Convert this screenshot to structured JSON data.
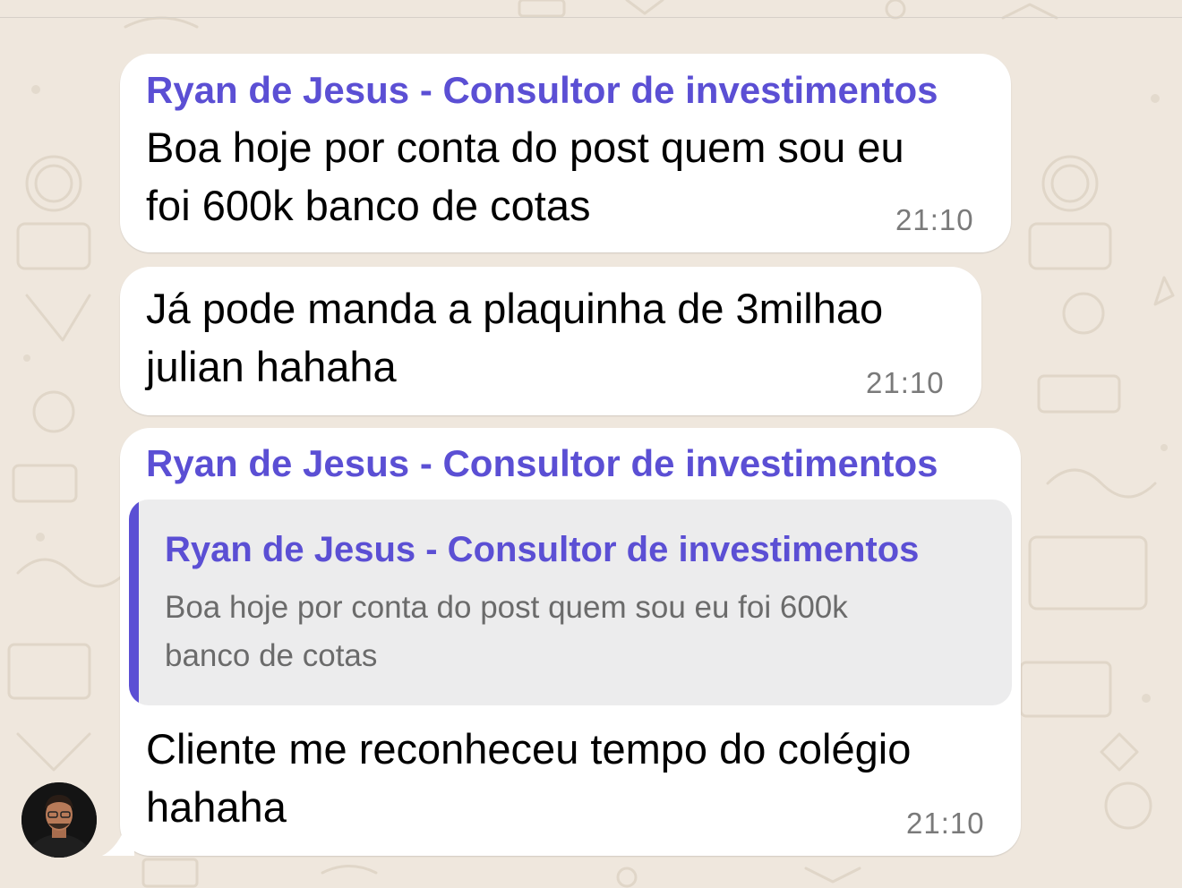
{
  "messages": [
    {
      "sender": "Ryan de Jesus - Consultor de investimentos",
      "lines": [
        "Boa hoje por conta do post quem sou eu",
        "foi 600k banco de cotas"
      ],
      "time": "21:10"
    },
    {
      "lines": [
        "Já pode manda a plaquinha de 3milhao",
        "julian hahaha"
      ],
      "time": "21:10"
    },
    {
      "sender": "Ryan de Jesus - Consultor de investimentos",
      "reply": {
        "sender": "Ryan de Jesus - Consultor de investimentos",
        "lines": [
          "Boa hoje por conta do post quem sou eu foi 600k",
          "banco de cotas"
        ]
      },
      "lines": [
        "Cliente me reconheceu tempo do colégio",
        "hahaha"
      ],
      "time": "21:10"
    }
  ],
  "colors": {
    "sender_name": "#5b4fd4",
    "bubble": "#ffffff",
    "wallpaper": "#efe7dd",
    "timestamp": "#7a7a7a",
    "quote_background": "#ececed"
  },
  "icons": [
    "sender-avatar-icon",
    "wallpaper-doodle-icon"
  ]
}
